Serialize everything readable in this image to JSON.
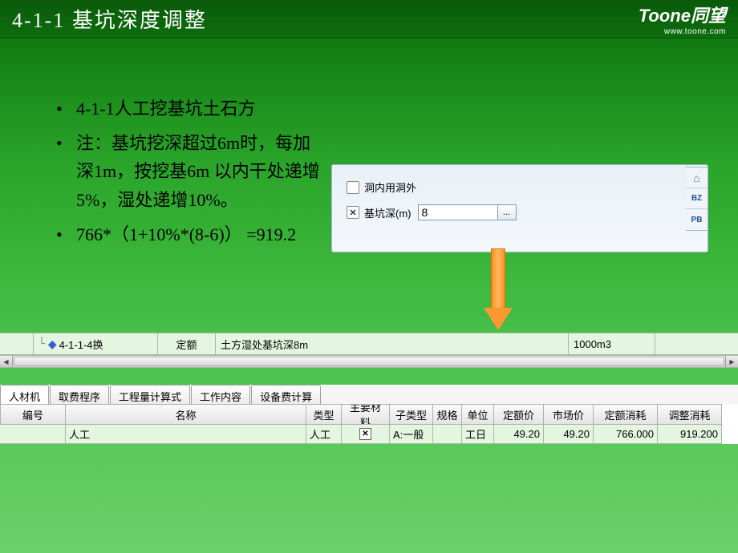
{
  "header": {
    "title": "4-1-1  基坑深度调整"
  },
  "logo": {
    "brand": "Toone同望",
    "url": "www.toone.com"
  },
  "bullets": {
    "b1": "4-1-1人工挖基坑土石方",
    "b2": "注：基坑挖深超过6m时，每加深1m，按挖基6m 以内干处递增5%，湿处递增10%。",
    "b3": "766*（1+10%*(8-6)） =919.2"
  },
  "popup": {
    "opt1_label": "洞内用洞外",
    "opt2_label": "基坑深(m)",
    "depth_value": "8",
    "more_btn": "..."
  },
  "side": {
    "i1": "⌂",
    "i2": "BZ",
    "i3": "PB"
  },
  "quota": {
    "code": "4-1-1-4换",
    "type": "定额",
    "desc": "土方湿处基坑深8m",
    "unit": "1000m3"
  },
  "tabs": {
    "t0": "人材机",
    "t1": "取费程序",
    "t2": "工程量计算式",
    "t3": "工作内容",
    "t4": "设备费计算"
  },
  "gridHeaders": {
    "h0": "编号",
    "h1": "名称",
    "h2": "类型",
    "h3": "主要材料",
    "h4": "子类型",
    "h5": "规格",
    "h6": "单位",
    "h7": "定额价",
    "h8": "市场价",
    "h9": "定额消耗",
    "h10": "调整消耗"
  },
  "gridRow": {
    "c0": "",
    "c1": "人工",
    "c2": "人工",
    "c4": "A:一般",
    "c5": "",
    "c6": "工日",
    "c7": "49.20",
    "c8": "49.20",
    "c9": "766.000",
    "c10": "919.200"
  }
}
